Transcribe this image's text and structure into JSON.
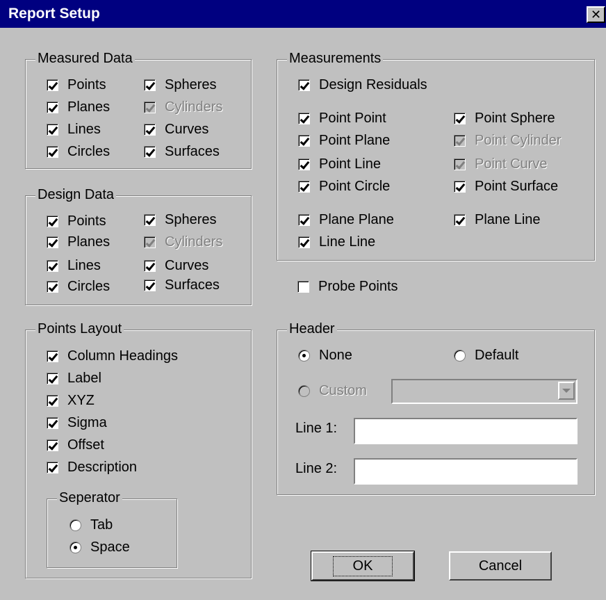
{
  "window": {
    "title": "Report Setup",
    "close_symbol": "✕"
  },
  "measured_data": {
    "title": "Measured Data",
    "items": [
      {
        "label": "Points",
        "checked": true,
        "enabled": true
      },
      {
        "label": "Planes",
        "checked": true,
        "enabled": true
      },
      {
        "label": "Lines",
        "checked": true,
        "enabled": true
      },
      {
        "label": "Circles",
        "checked": true,
        "enabled": true
      },
      {
        "label": "Spheres",
        "checked": true,
        "enabled": true
      },
      {
        "label": "Cylinders",
        "checked": true,
        "enabled": false
      },
      {
        "label": "Curves",
        "checked": true,
        "enabled": true
      },
      {
        "label": "Surfaces",
        "checked": true,
        "enabled": true
      }
    ]
  },
  "design_data": {
    "title": "Design Data",
    "items": [
      {
        "label": "Points",
        "checked": true,
        "enabled": true
      },
      {
        "label": "Planes",
        "checked": true,
        "enabled": true
      },
      {
        "label": "Lines",
        "checked": true,
        "enabled": true
      },
      {
        "label": "Circles",
        "checked": true,
        "enabled": true
      },
      {
        "label": "Spheres",
        "checked": true,
        "enabled": true
      },
      {
        "label": "Cylinders",
        "checked": true,
        "enabled": false
      },
      {
        "label": "Curves",
        "checked": true,
        "enabled": true
      },
      {
        "label": "Surfaces",
        "checked": true,
        "enabled": true
      }
    ]
  },
  "points_layout": {
    "title": "Points Layout",
    "items": [
      {
        "label": "Column Headings",
        "checked": true
      },
      {
        "label": "Label",
        "checked": true
      },
      {
        "label": "XYZ",
        "checked": true
      },
      {
        "label": "Sigma",
        "checked": true
      },
      {
        "label": "Offset",
        "checked": true
      },
      {
        "label": "Description",
        "checked": true
      }
    ],
    "separator": {
      "title": "Seperator",
      "options": [
        {
          "label": "Tab",
          "selected": false
        },
        {
          "label": "Space",
          "selected": true
        }
      ]
    }
  },
  "measurements": {
    "title": "Measurements",
    "items": [
      {
        "label": "Design Residuals",
        "checked": true,
        "enabled": true
      },
      {
        "label": "Point Point",
        "checked": true,
        "enabled": true
      },
      {
        "label": "Point Plane",
        "checked": true,
        "enabled": true
      },
      {
        "label": "Point Line",
        "checked": true,
        "enabled": true
      },
      {
        "label": "Point Circle",
        "checked": true,
        "enabled": true
      },
      {
        "label": "Point Sphere",
        "checked": true,
        "enabled": true
      },
      {
        "label": "Point Cylinder",
        "checked": true,
        "enabled": false
      },
      {
        "label": "Point Curve",
        "checked": true,
        "enabled": false
      },
      {
        "label": "Point Surface",
        "checked": true,
        "enabled": true
      },
      {
        "label": "Plane Plane",
        "checked": true,
        "enabled": true
      },
      {
        "label": "Line Line",
        "checked": true,
        "enabled": true
      },
      {
        "label": "Plane Line",
        "checked": true,
        "enabled": true
      }
    ]
  },
  "probe_points": {
    "label": "Probe Points",
    "checked": false
  },
  "header": {
    "title": "Header",
    "options": [
      {
        "label": "None",
        "selected": true,
        "enabled": true
      },
      {
        "label": "Default",
        "selected": false,
        "enabled": true
      },
      {
        "label": "Custom",
        "selected": false,
        "enabled": false
      }
    ],
    "custom_value": "",
    "line1_label": "Line 1:",
    "line1_value": "",
    "line2_label": "Line 2:",
    "line2_value": ""
  },
  "buttons": {
    "ok": "OK",
    "cancel": "Cancel"
  }
}
